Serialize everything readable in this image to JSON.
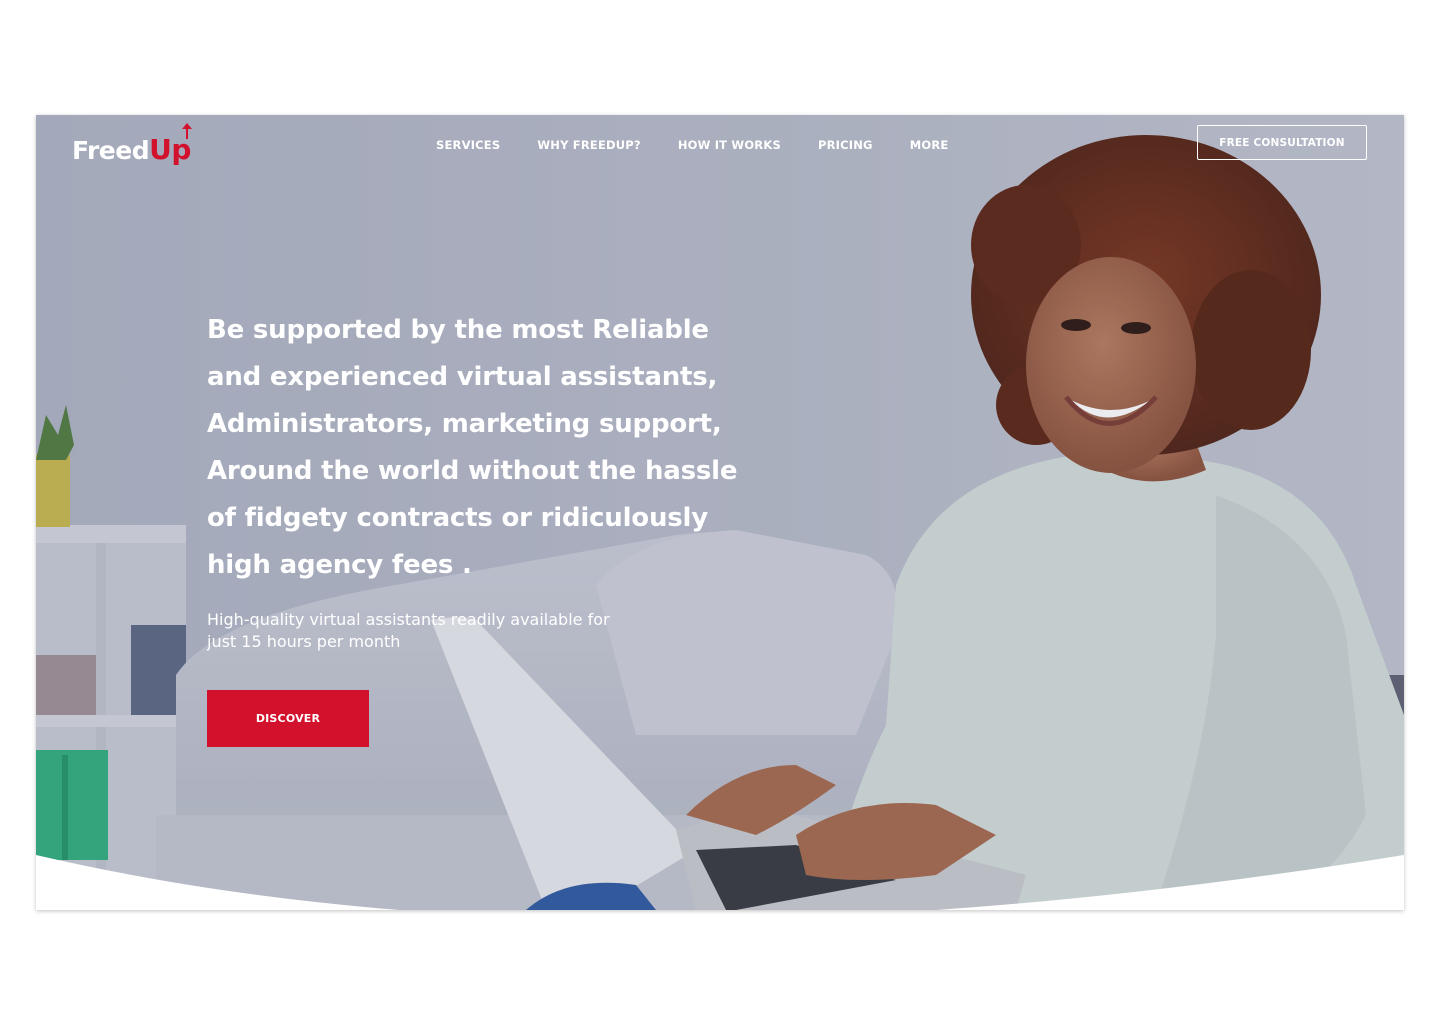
{
  "brand": {
    "logo_main": "Freed",
    "logo_accent": "Up",
    "accent_color": "#d2112d"
  },
  "nav": {
    "items": [
      {
        "label": "SERVICES"
      },
      {
        "label": "WHY FREEDUP?"
      },
      {
        "label": "HOW IT WORKS"
      },
      {
        "label": "PRICING"
      },
      {
        "label": "MORE"
      }
    ],
    "cta_label": "FREE CONSULTATION"
  },
  "hero": {
    "headline_lines": [
      "Be supported by the most Reliable",
      "and experienced virtual assistants,",
      "Administrators, marketing support,",
      "Around the world without the hassle",
      "of fidgety contracts or ridiculously",
      "high agency fees ."
    ],
    "subline_lines": [
      "High-quality virtual assistants readily available for",
      "just 15 hours per month"
    ],
    "button_label": "DISCOVER",
    "image_subject": "woman-with-laptop-photo"
  }
}
